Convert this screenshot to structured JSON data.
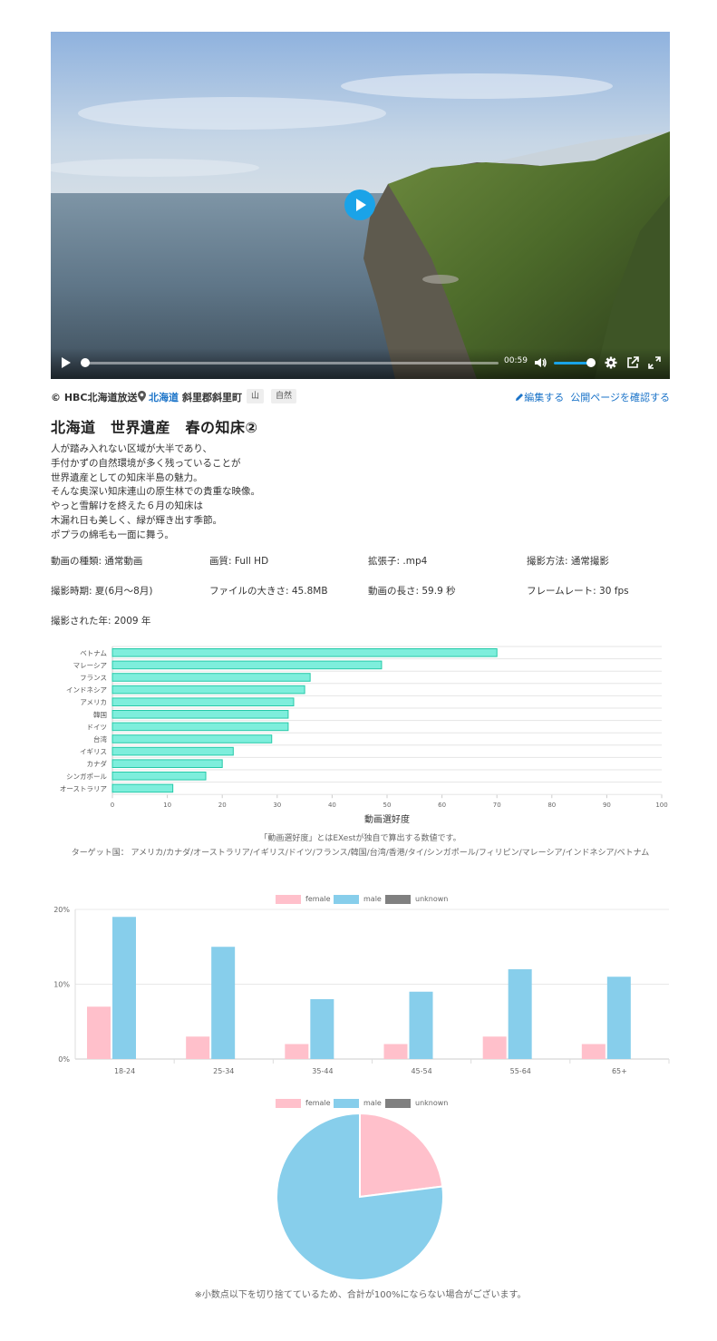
{
  "video": {
    "time": "00:59",
    "icons": [
      "play-icon",
      "volume-icon",
      "settings-icon",
      "external-link-icon",
      "fullscreen-icon"
    ],
    "accent": "#1aa3e8"
  },
  "meta": {
    "credit": "© HBC北海道放送",
    "prefecture": "北海道",
    "city": "斜里郡斜里町",
    "tags": [
      "山",
      "自然"
    ],
    "edit_link": "編集する",
    "public_link": "公開ページを確認する"
  },
  "title": "北海道　世界遺産　春の知床②",
  "description": [
    "人が踏み入れない区域が大半であり、",
    "手付かずの自然環境が多く残っていることが",
    "世界遺産としての知床半島の魅力。",
    "そんな奥深い知床連山の原生林での貴重な映像。",
    "やっと雪解けを終えた６月の知床は",
    "木漏れ日も美しく、緑が輝き出す季節。",
    "ポプラの綿毛も一面に舞う。"
  ],
  "specs": [
    "動画の種類: 通常動画",
    "画質: Full HD",
    "拡張子: .mp4",
    "撮影方法: 通常撮影",
    "撮影時期: 夏(6月〜8月)",
    "ファイルの大きさ: 45.8MB",
    "動画の長さ: 59.9 秒",
    "フレームレート: 30 fps",
    "撮影された年: 2009 年"
  ],
  "notes": {
    "popularity": "「動画選好度」とはEXestが独自で算出する数値です。",
    "targets": "ターゲット国： アメリカ/カナダ/オーストラリア/イギリス/ドイツ/フランス/韓国/台湾/香港/タイ/シンガポール/フィリピン/マレーシア/インドネシア/ベトナム",
    "footnote": "※小数点以下を切り捨てているため、合計が100%にならない場合がございます。"
  },
  "chart_data": [
    {
      "type": "bar",
      "orientation": "horizontal",
      "categories": [
        "ベトナム",
        "マレーシア",
        "フランス",
        "インドネシア",
        "アメリカ",
        "韓国",
        "ドイツ",
        "台湾",
        "イギリス",
        "カナダ",
        "シンガポール",
        "オーストラリア"
      ],
      "values": [
        70,
        49,
        36,
        35,
        33,
        32,
        32,
        29,
        22,
        20,
        17,
        11
      ],
      "xlabel": "動画選好度",
      "xlim": [
        0,
        100
      ],
      "xticks": [
        0,
        10,
        20,
        30,
        40,
        50,
        60,
        70,
        80,
        90,
        100
      ],
      "color": "#7eeedc",
      "border": "#27c9a8"
    },
    {
      "type": "bar",
      "categories": [
        "18-24",
        "25-34",
        "35-44",
        "45-54",
        "55-64",
        "65+"
      ],
      "series": [
        {
          "name": "female",
          "values": [
            7,
            3,
            2,
            2,
            3,
            2
          ],
          "color": "#ffc0cb"
        },
        {
          "name": "male",
          "values": [
            19,
            15,
            8,
            9,
            12,
            11
          ],
          "color": "#87ceeb"
        },
        {
          "name": "unknown",
          "values": [
            0,
            0,
            0,
            0,
            0,
            0
          ],
          "color": "#808080"
        }
      ],
      "ylim": [
        0,
        20
      ],
      "yticks": [
        "0%",
        "10%",
        "20%"
      ],
      "legend": "top"
    },
    {
      "type": "pie",
      "series": [
        {
          "name": "female",
          "value": 23,
          "color": "#ffc0cb"
        },
        {
          "name": "male",
          "value": 77,
          "color": "#87ceeb"
        },
        {
          "name": "unknown",
          "value": 0,
          "color": "#808080"
        }
      ],
      "legend": "top"
    }
  ]
}
